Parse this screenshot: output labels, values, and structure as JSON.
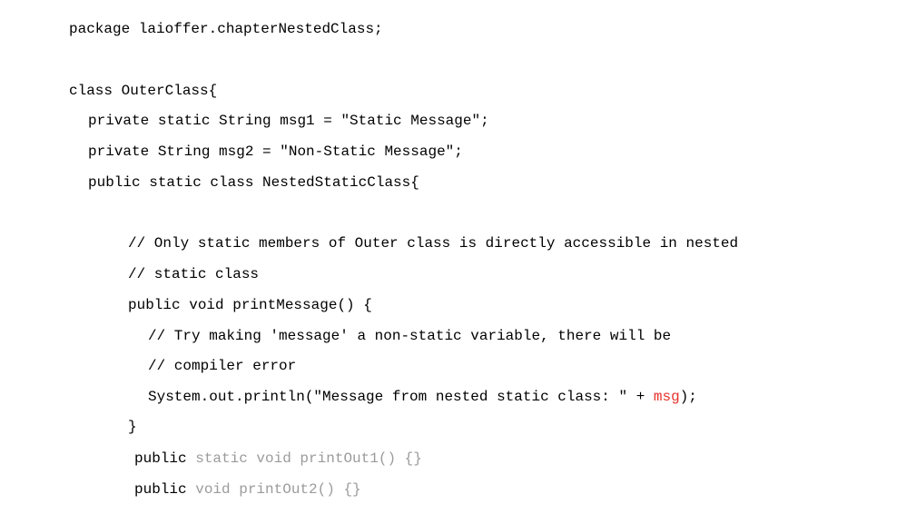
{
  "colors": {
    "text": "#000000",
    "highlight_red": "#e8312a",
    "muted_gray": "#9b9b9b",
    "background": "#ffffff"
  },
  "code": {
    "package_line": "package laioffer.chapterNestedClass;",
    "class_decl": "class OuterClass{",
    "field_msg1": "private static String msg1 = \"Static Message\";",
    "field_msg2": "private String msg2 = \"Non-Static Message\";",
    "nested_class_decl": "public static class NestedStaticClass{",
    "comment_1": "// Only static members of Outer class is directly accessible in nested",
    "comment_2": "// static class",
    "method_decl": "public void printMessage() {",
    "comment_3": "// Try making 'message' a non-static variable, there will be",
    "comment_4": "// compiler error",
    "println_prefix": "System.out.println(\"Message from nested static class: \" + ",
    "println_var": "msg",
    "println_suffix": ");",
    "close_brace": "}",
    "printout1_keyword": "public",
    "printout1_rest": " static void printOut1() {}",
    "printout2_keyword": "public",
    "printout2_rest": " void printOut2() {}"
  }
}
